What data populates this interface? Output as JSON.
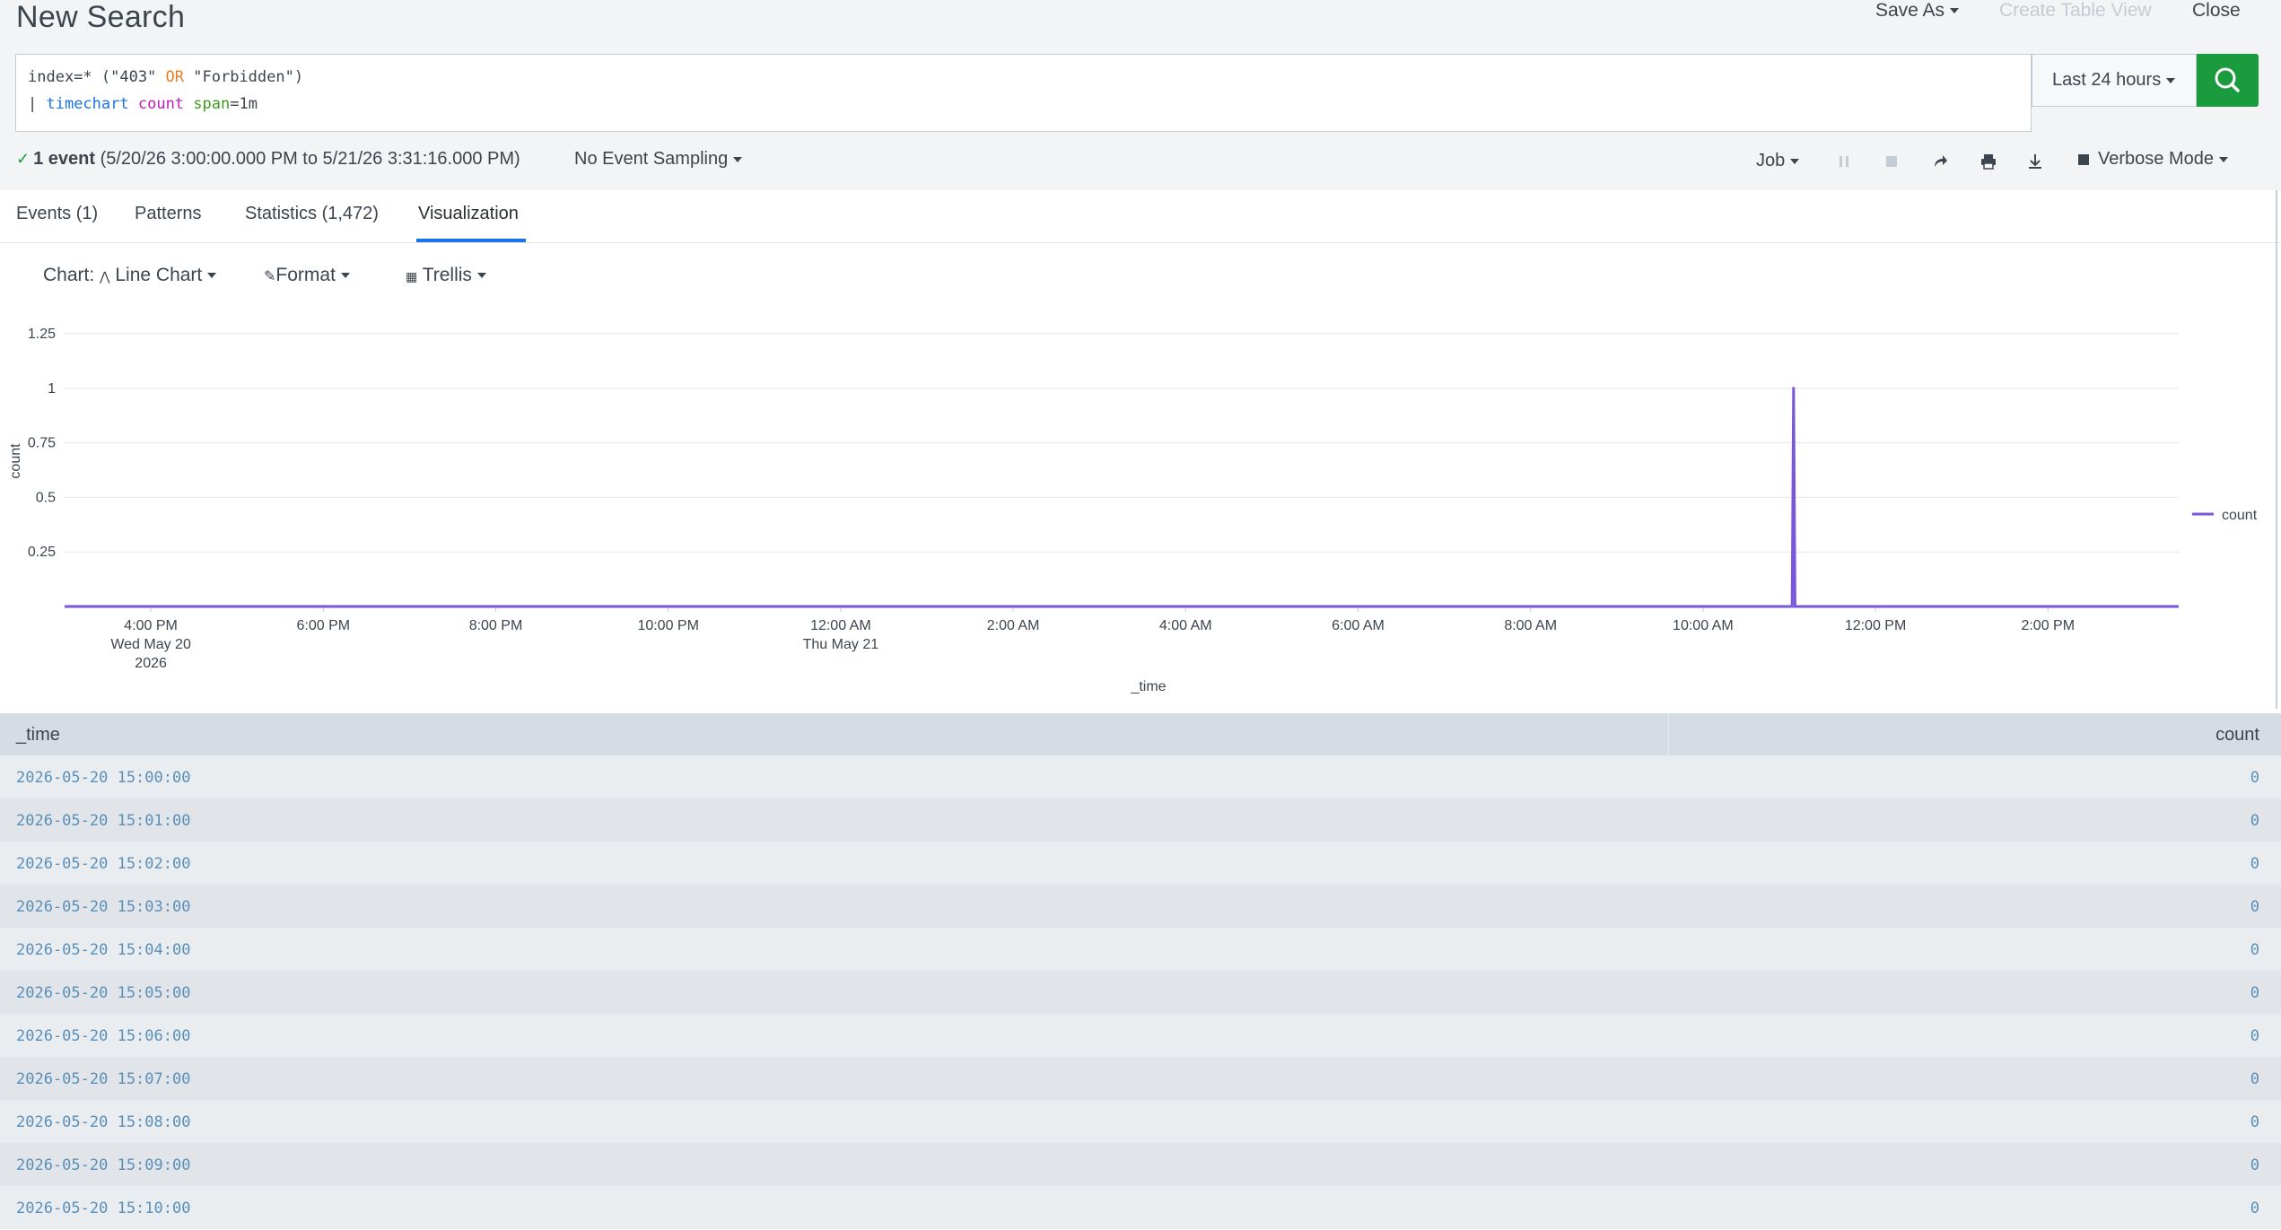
{
  "header": {
    "title": "New Search",
    "save_as": "Save As",
    "create_table_view": "Create Table View",
    "close": "Close"
  },
  "search": {
    "line1_prefix": "index=* (\"403\" ",
    "line1_or": "OR",
    "line1_suffix": " \"Forbidden\")",
    "line2_pipe": "| ",
    "line2_cmd": "timechart",
    "line2_fn": "count",
    "line2_arg": "span",
    "line2_val": "=1m",
    "time_range": "Last 24 hours"
  },
  "status": {
    "events": "1 event",
    "range": "(5/20/26 3:00:00.000 PM to 5/21/26 3:31:16.000 PM)",
    "sampling": "No Event Sampling",
    "job": "Job",
    "mode": "Verbose Mode"
  },
  "tabs": [
    {
      "label": "Events (1)"
    },
    {
      "label": "Patterns"
    },
    {
      "label": "Statistics (1,472)"
    },
    {
      "label": "Visualization"
    }
  ],
  "viz_controls": {
    "chart_prefix": "Chart:",
    "chart_type": "Line Chart",
    "format": "Format",
    "trellis": "Trellis"
  },
  "chart_data": {
    "type": "line",
    "xlabel": "_time",
    "ylabel": "count",
    "ylim": [
      0,
      1.25
    ],
    "yticks": [
      "0.25",
      "0.5",
      "0.75",
      "1",
      "1.25"
    ],
    "x_tick_labels": [
      [
        "4:00 PM",
        "Wed May 20",
        "2026"
      ],
      [
        "6:00 PM"
      ],
      [
        "8:00 PM"
      ],
      [
        "10:00 PM"
      ],
      [
        "12:00 AM",
        "Thu May 21"
      ],
      [
        "2:00 AM"
      ],
      [
        "4:00 AM"
      ],
      [
        "6:00 AM"
      ],
      [
        "8:00 AM"
      ],
      [
        "10:00 AM"
      ],
      [
        "12:00 PM"
      ],
      [
        "2:00 PM"
      ]
    ],
    "series": [
      {
        "name": "count",
        "color": "#7b56db",
        "points": [
          {
            "x": "2026-05-20 15:00:00",
            "y": 0
          },
          {
            "x": "2026-05-21 11:02:00",
            "y": 0
          },
          {
            "x": "2026-05-21 11:03:00",
            "y": 1
          },
          {
            "x": "2026-05-21 11:04:00",
            "y": 0
          },
          {
            "x": "2026-05-21 15:31:00",
            "y": 0
          }
        ]
      }
    ],
    "legend": "right"
  },
  "table": {
    "columns": [
      "_time",
      "count"
    ],
    "rows": [
      [
        "2026-05-20 15:00:00",
        "0"
      ],
      [
        "2026-05-20 15:01:00",
        "0"
      ],
      [
        "2026-05-20 15:02:00",
        "0"
      ],
      [
        "2026-05-20 15:03:00",
        "0"
      ],
      [
        "2026-05-20 15:04:00",
        "0"
      ],
      [
        "2026-05-20 15:05:00",
        "0"
      ],
      [
        "2026-05-20 15:06:00",
        "0"
      ],
      [
        "2026-05-20 15:07:00",
        "0"
      ],
      [
        "2026-05-20 15:08:00",
        "0"
      ],
      [
        "2026-05-20 15:09:00",
        "0"
      ],
      [
        "2026-05-20 15:10:00",
        "0"
      ]
    ]
  }
}
